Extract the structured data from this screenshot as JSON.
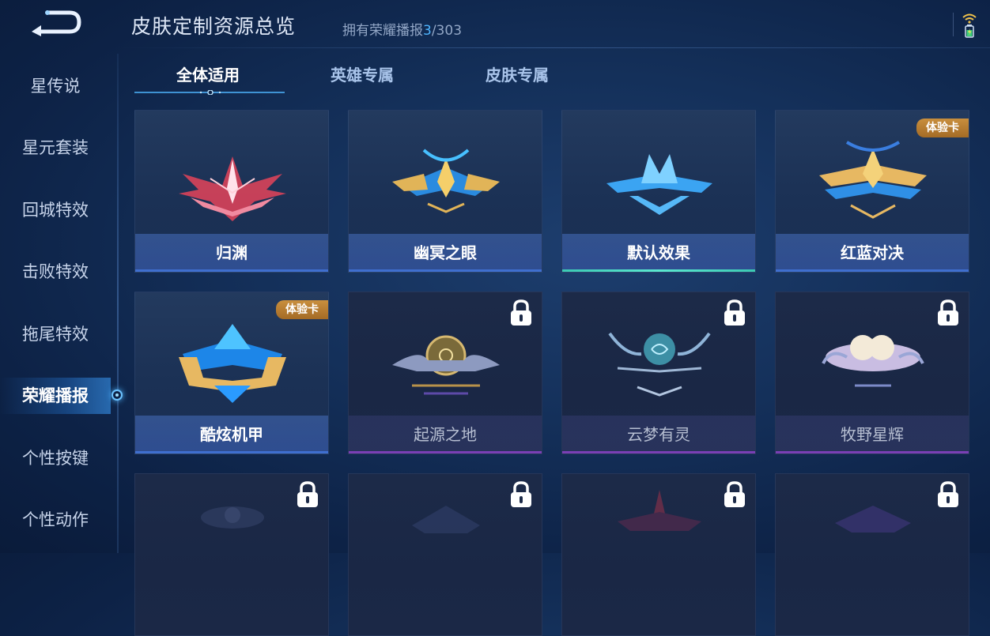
{
  "header": {
    "title": "皮肤定制资源总览",
    "summary_prefix": "拥有荣耀播报",
    "owned": "3",
    "summary_total": "/303"
  },
  "sidebar": {
    "items": [
      {
        "label": "星传说"
      },
      {
        "label": "星元套装"
      },
      {
        "label": "回城特效"
      },
      {
        "label": "击败特效"
      },
      {
        "label": "拖尾特效"
      },
      {
        "label": "荣耀播报",
        "active": true
      },
      {
        "label": "个性按键"
      },
      {
        "label": "个性动作"
      }
    ]
  },
  "tabs": [
    {
      "label": "全体适用",
      "active": true
    },
    {
      "label": "英雄专属"
    },
    {
      "label": "皮肤专属"
    }
  ],
  "cards": [
    {
      "label": "归渊",
      "state": "owned"
    },
    {
      "label": "幽冥之眼",
      "state": "owned"
    },
    {
      "label": "默认效果",
      "state": "selected"
    },
    {
      "label": "红蓝对决",
      "state": "trial",
      "badge": "体验卡"
    },
    {
      "label": "酷炫机甲",
      "state": "trial",
      "badge": "体验卡"
    },
    {
      "label": "起源之地",
      "state": "locked"
    },
    {
      "label": "云梦有灵",
      "state": "locked"
    },
    {
      "label": "牧野星辉",
      "state": "locked"
    },
    {
      "label": "",
      "state": "locked"
    },
    {
      "label": "",
      "state": "locked"
    },
    {
      "label": "",
      "state": "locked"
    },
    {
      "label": "",
      "state": "locked"
    }
  ],
  "colors": {
    "accent": "#4fb6ff",
    "trial_badge": "#b97d30",
    "selected_bar": "#4fdcc4"
  }
}
